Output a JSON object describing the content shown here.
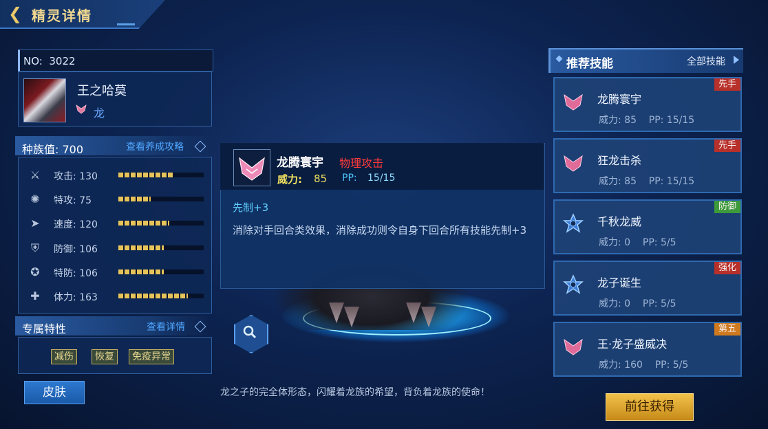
{
  "header": {
    "title": "精灵详情"
  },
  "pet": {
    "no_label": "NO:",
    "no_value": "3022",
    "name": "王之哈莫",
    "type": "龙"
  },
  "race": {
    "label": "种族值:",
    "value": "700",
    "guide_link": "查看养成攻略"
  },
  "stats": [
    {
      "label": "攻击:",
      "value": 130,
      "icon": "sword-icon"
    },
    {
      "label": "特攻:",
      "value": 75,
      "icon": "special-attack-icon"
    },
    {
      "label": "速度:",
      "value": 120,
      "icon": "speed-boot-icon"
    },
    {
      "label": "防御:",
      "value": 106,
      "icon": "shield-icon"
    },
    {
      "label": "特防:",
      "value": 106,
      "icon": "special-shield-icon"
    },
    {
      "label": "体力:",
      "value": 163,
      "icon": "health-icon"
    }
  ],
  "traits": {
    "title": "专属特性",
    "detail_link": "查看详情",
    "tags": [
      "减伤",
      "恢复",
      "免疫异常"
    ]
  },
  "skin_button": "皮肤",
  "description": "龙之子的完全体形态，闪耀着龙族的希望，背负着龙族的使命！",
  "popup": {
    "name": "龙腾寰宇",
    "category": "物理攻击",
    "power_label": "威力:",
    "power_value": "85",
    "pp_label": "PP:",
    "pp_value": "15/15",
    "priority": "先制+3",
    "desc": "消除对手回合类效果，消除成功则令自身下回合所有技能先制+3"
  },
  "recommend": {
    "title": "推荐技能",
    "all_link": "全部技能",
    "skills": [
      {
        "name": "龙腾寰宇",
        "power": "威力: 85",
        "pp": "PP:  15/15",
        "tag": "先手",
        "tag_color": "#b8302a",
        "icon": "dragon-wing-icon"
      },
      {
        "name": "狂龙击杀",
        "power": "威力: 85",
        "pp": "PP:  15/15",
        "tag": "先手",
        "tag_color": "#b8302a",
        "icon": "dragon-wing-icon"
      },
      {
        "name": "千秋龙威",
        "power": "威力: 0",
        "pp": "PP:  5/5",
        "tag": "防御",
        "tag_color": "#3c9a3a",
        "icon": "star-emblem-icon"
      },
      {
        "name": "龙子诞生",
        "power": "威力: 0",
        "pp": "PP:  5/5",
        "tag": "强化",
        "tag_color": "#b8302a",
        "icon": "star-emblem-icon"
      },
      {
        "name": "王·龙子盛威决",
        "power": "威力: 160",
        "pp": "PP:  5/5",
        "tag": "第五",
        "tag_color": "#d07a20",
        "icon": "dragon-wing-icon"
      }
    ]
  },
  "get_button": "前往获得",
  "stat_max": 200
}
